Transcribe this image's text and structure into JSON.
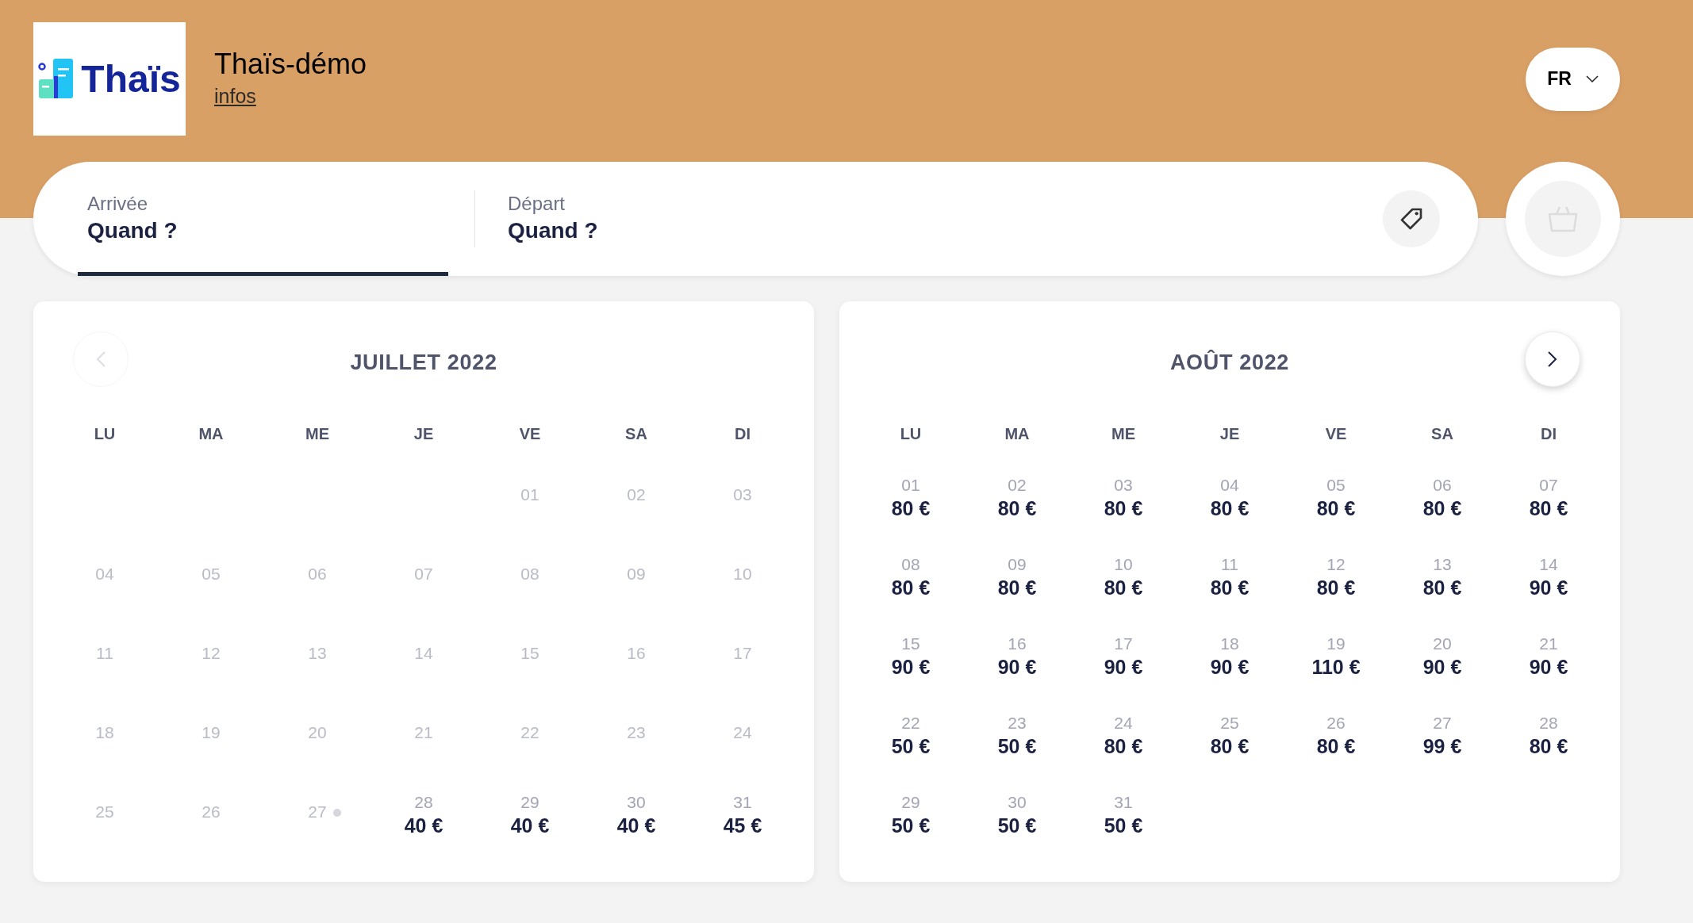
{
  "header": {
    "logo_text": "Thaïs",
    "title": "Thaïs-démo",
    "link": "infos",
    "language": "FR"
  },
  "search": {
    "fields": [
      {
        "label": "Arrivée",
        "value": "Quand ?",
        "selected": true
      },
      {
        "label": "Départ",
        "value": "Quand ?",
        "selected": false
      }
    ]
  },
  "cart": {
    "disabled": true
  },
  "months": [
    {
      "title": "JUILLET 2022",
      "nav": {
        "kind": "prev",
        "disabled": true
      },
      "weekdays": [
        "LU",
        "MA",
        "ME",
        "JE",
        "VE",
        "SA",
        "DI"
      ],
      "days": [
        {
          "kind": "blank"
        },
        {
          "kind": "blank"
        },
        {
          "kind": "blank"
        },
        {
          "kind": "blank"
        },
        {
          "kind": "past",
          "day": "01"
        },
        {
          "kind": "past",
          "day": "02"
        },
        {
          "kind": "past",
          "day": "03"
        },
        {
          "kind": "past",
          "day": "04"
        },
        {
          "kind": "past",
          "day": "05"
        },
        {
          "kind": "past",
          "day": "06"
        },
        {
          "kind": "past",
          "day": "07"
        },
        {
          "kind": "past",
          "day": "08"
        },
        {
          "kind": "past",
          "day": "09"
        },
        {
          "kind": "past",
          "day": "10"
        },
        {
          "kind": "past",
          "day": "11"
        },
        {
          "kind": "past",
          "day": "12"
        },
        {
          "kind": "past",
          "day": "13"
        },
        {
          "kind": "past",
          "day": "14"
        },
        {
          "kind": "past",
          "day": "15"
        },
        {
          "kind": "past",
          "day": "16"
        },
        {
          "kind": "past",
          "day": "17"
        },
        {
          "kind": "past",
          "day": "18"
        },
        {
          "kind": "past",
          "day": "19"
        },
        {
          "kind": "past",
          "day": "20"
        },
        {
          "kind": "past",
          "day": "21"
        },
        {
          "kind": "past",
          "day": "22"
        },
        {
          "kind": "past",
          "day": "23"
        },
        {
          "kind": "past",
          "day": "24"
        },
        {
          "kind": "past",
          "day": "25"
        },
        {
          "kind": "past",
          "day": "26"
        },
        {
          "kind": "past",
          "day": "27",
          "today": true
        },
        {
          "kind": "price",
          "day": "28",
          "price": "40 €"
        },
        {
          "kind": "price",
          "day": "29",
          "price": "40 €"
        },
        {
          "kind": "price",
          "day": "30",
          "price": "40 €"
        },
        {
          "kind": "price",
          "day": "31",
          "price": "45 €"
        }
      ]
    },
    {
      "title": "AOÛT 2022",
      "nav": {
        "kind": "next",
        "disabled": false
      },
      "weekdays": [
        "LU",
        "MA",
        "ME",
        "JE",
        "VE",
        "SA",
        "DI"
      ],
      "days": [
        {
          "kind": "price",
          "day": "01",
          "price": "80 €"
        },
        {
          "kind": "price",
          "day": "02",
          "price": "80 €"
        },
        {
          "kind": "price",
          "day": "03",
          "price": "80 €"
        },
        {
          "kind": "price",
          "day": "04",
          "price": "80 €"
        },
        {
          "kind": "price",
          "day": "05",
          "price": "80 €"
        },
        {
          "kind": "price",
          "day": "06",
          "price": "80 €"
        },
        {
          "kind": "price",
          "day": "07",
          "price": "80 €"
        },
        {
          "kind": "price",
          "day": "08",
          "price": "80 €"
        },
        {
          "kind": "price",
          "day": "09",
          "price": "80 €"
        },
        {
          "kind": "price",
          "day": "10",
          "price": "80 €"
        },
        {
          "kind": "price",
          "day": "11",
          "price": "80 €"
        },
        {
          "kind": "price",
          "day": "12",
          "price": "80 €"
        },
        {
          "kind": "price",
          "day": "13",
          "price": "80 €"
        },
        {
          "kind": "price",
          "day": "14",
          "price": "90 €"
        },
        {
          "kind": "price",
          "day": "15",
          "price": "90 €"
        },
        {
          "kind": "price",
          "day": "16",
          "price": "90 €"
        },
        {
          "kind": "price",
          "day": "17",
          "price": "90 €"
        },
        {
          "kind": "price",
          "day": "18",
          "price": "90 €"
        },
        {
          "kind": "price",
          "day": "19",
          "price": "110 €"
        },
        {
          "kind": "price",
          "day": "20",
          "price": "90 €"
        },
        {
          "kind": "price",
          "day": "21",
          "price": "90 €"
        },
        {
          "kind": "price",
          "day": "22",
          "price": "50 €"
        },
        {
          "kind": "price",
          "day": "23",
          "price": "50 €"
        },
        {
          "kind": "price",
          "day": "24",
          "price": "80 €"
        },
        {
          "kind": "price",
          "day": "25",
          "price": "80 €"
        },
        {
          "kind": "price",
          "day": "26",
          "price": "80 €"
        },
        {
          "kind": "price",
          "day": "27",
          "price": "99 €"
        },
        {
          "kind": "price",
          "day": "28",
          "price": "80 €"
        },
        {
          "kind": "price",
          "day": "29",
          "price": "50 €"
        },
        {
          "kind": "price",
          "day": "30",
          "price": "50 €"
        },
        {
          "kind": "price",
          "day": "31",
          "price": "50 €"
        }
      ]
    }
  ]
}
